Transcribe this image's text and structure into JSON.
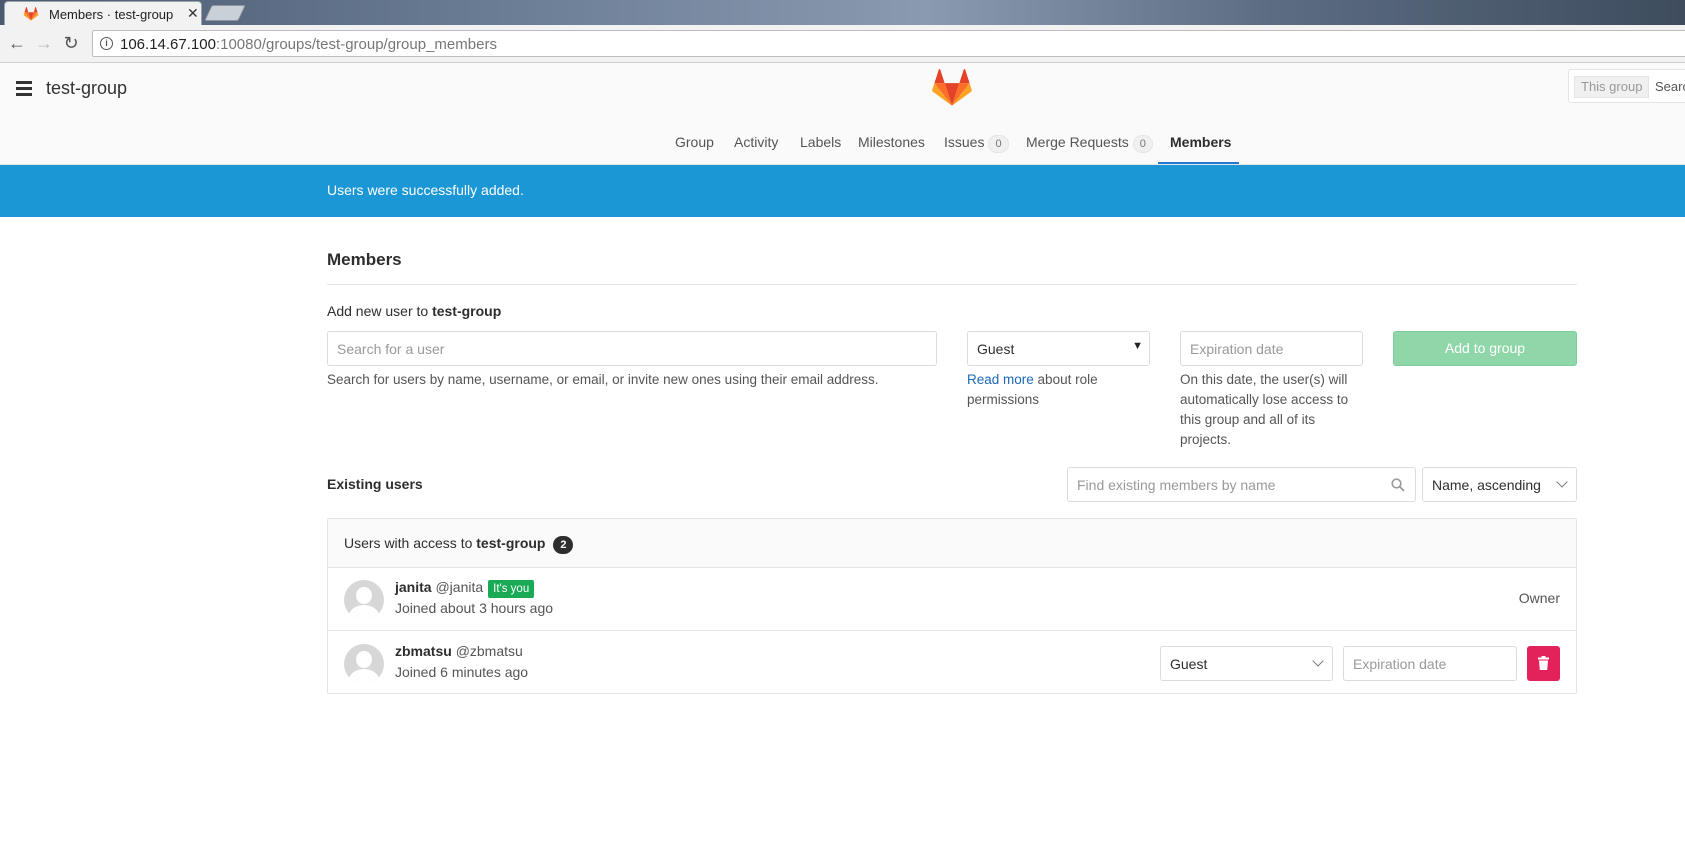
{
  "browser": {
    "tab_title": "Members · test-group ·",
    "tab_close": "✕",
    "url_host": "106.14.67.100",
    "url_rest": ":10080/groups/test-group/group_members"
  },
  "header": {
    "group_title": "test-group",
    "search_scope": "This group",
    "search_placeholder": "Search"
  },
  "nav": {
    "group": "Group",
    "activity": "Activity",
    "labels": "Labels",
    "milestones": "Milestones",
    "issues": "Issues",
    "issues_count": "0",
    "merge_requests": "Merge Requests",
    "merge_requests_count": "0",
    "members": "Members"
  },
  "flash": {
    "message": "Users were successfully added."
  },
  "page": {
    "title": "Members",
    "add_label_prefix": "Add new user to ",
    "add_label_group": "test-group"
  },
  "add_form": {
    "user_search_placeholder": "Search for a user",
    "user_search_help": "Search for users by name, username, or email, or invite new ones using their email address.",
    "role_value": "Guest",
    "role_help_link": "Read more",
    "role_help_text": " about role permissions",
    "expiration_placeholder": "Expiration date",
    "expiration_help": "On this date, the user(s) will automatically lose access to this group and all of its projects.",
    "submit_label": "Add to group"
  },
  "existing": {
    "label": "Existing users",
    "filter_placeholder": "Find existing members by name",
    "sort_value": "Name, ascending"
  },
  "panel": {
    "head_prefix": "Users with access to ",
    "head_group": "test-group",
    "count": "2",
    "members": [
      {
        "name": "janita",
        "handle": "@janita",
        "badge": "It's you",
        "joined": "Joined about 3 hours ago",
        "role": "Owner"
      },
      {
        "name": "zbmatsu",
        "handle": "@zbmatsu",
        "joined": "Joined 6 minutes ago",
        "role": "Guest",
        "expiration_placeholder": "Expiration date"
      }
    ]
  },
  "colors": {
    "flash_bg": "#1b97d5",
    "add_button": "#8fd7a8",
    "delete_button": "#e3215a",
    "you_badge": "#1aaa55",
    "active_tab_underline": "#1f78d1"
  }
}
